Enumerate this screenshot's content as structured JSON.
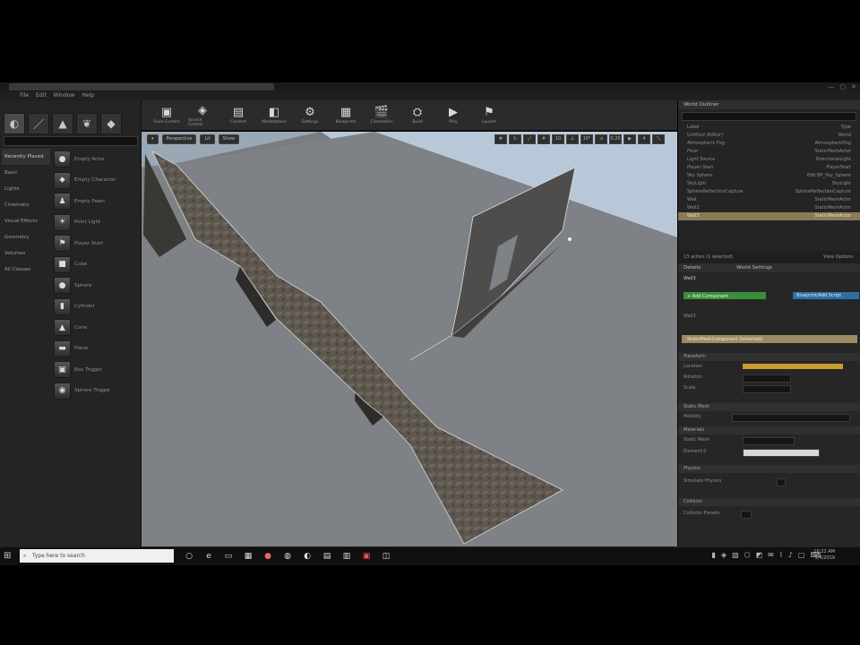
{
  "menubar": {
    "items": [
      "File",
      "Edit",
      "Window",
      "Help"
    ]
  },
  "modes": {
    "categories": [
      "Recently Placed",
      "Basic",
      "Lights",
      "Cinematic",
      "Visual Effects",
      "Geometry",
      "Volumes",
      "All Classes"
    ],
    "place_items": [
      "Empty Actor",
      "Empty Character",
      "Empty Pawn",
      "Point Light",
      "Player Start",
      "Cube",
      "Sphere",
      "Cylinder",
      "Cone",
      "Plane",
      "Box Trigger",
      "Sphere Trigger"
    ]
  },
  "toolbar": {
    "buttons": [
      {
        "label": "Save Current",
        "icon": "save-icon",
        "glyph": "▣"
      },
      {
        "label": "Source Control",
        "icon": "source-control-icon",
        "glyph": "◈"
      },
      {
        "label": "Content",
        "icon": "content-icon",
        "glyph": "▤"
      },
      {
        "label": "Marketplace",
        "icon": "marketplace-icon",
        "glyph": "◧"
      },
      {
        "label": "Settings",
        "icon": "settings-icon",
        "glyph": "⚙"
      },
      {
        "label": "Blueprints",
        "icon": "blueprints-icon",
        "glyph": "▦"
      },
      {
        "label": "Cinematics",
        "icon": "cinematics-icon",
        "glyph": "🎬"
      },
      {
        "label": "Build",
        "icon": "build-icon",
        "glyph": "⛭"
      },
      {
        "label": "Play",
        "icon": "play-icon",
        "glyph": "▶"
      },
      {
        "label": "Launch",
        "icon": "launch-icon",
        "glyph": "⚑"
      }
    ]
  },
  "viewport": {
    "view_mode": "Perspective",
    "lit_mode": "Lit",
    "show": "Show",
    "grid_snap": "10",
    "rot_snap": "10°",
    "scale_snap": "0.25",
    "cam_speed": "4"
  },
  "outliner": {
    "tab": "World Outliner",
    "rows": [
      {
        "label": "Label",
        "type": "Type"
      },
      {
        "label": "Untitled (Editor)",
        "type": "World"
      },
      {
        "label": "Atmospheric Fog",
        "type": "AtmosphericFog"
      },
      {
        "label": "Floor",
        "type": "StaticMeshActor"
      },
      {
        "label": "Light Source",
        "type": "DirectionalLight"
      },
      {
        "label": "Player Start",
        "type": "PlayerStart"
      },
      {
        "label": "Sky Sphere",
        "type": "Edit BP_Sky_Sphere"
      },
      {
        "label": "SkyLight",
        "type": "SkyLight"
      },
      {
        "label": "SphereReflectionCapture",
        "type": "SphereReflectionCapture"
      },
      {
        "label": "Wall",
        "type": "StaticMeshActor"
      },
      {
        "label": "Wall2",
        "type": "StaticMeshActor"
      },
      {
        "label": "Wall3",
        "type": "StaticMeshActor"
      }
    ],
    "selected_index": 11,
    "footer": "13 actors (1 selected)",
    "view_options": "View Options"
  },
  "details": {
    "tab": "Details",
    "search_tab": "World Settings",
    "name": "Wall3",
    "add_component": "+ Add Component",
    "blueprint_btn": "Blueprint/Add Script",
    "selected_component": "StaticMeshComponent (Inherited)",
    "sections": [
      "Transform",
      "Static Mesh",
      "Materials",
      "Physics",
      "Collision"
    ],
    "rows": [
      "Location",
      "Rotation",
      "Scale",
      "Mobility",
      "Static Mesh",
      "Element 0",
      "Simulate Physics",
      "Collision Presets"
    ]
  },
  "taskbar": {
    "search_placeholder": "Type here to search",
    "time": "10:22 AM",
    "date": "5/4/2019"
  }
}
